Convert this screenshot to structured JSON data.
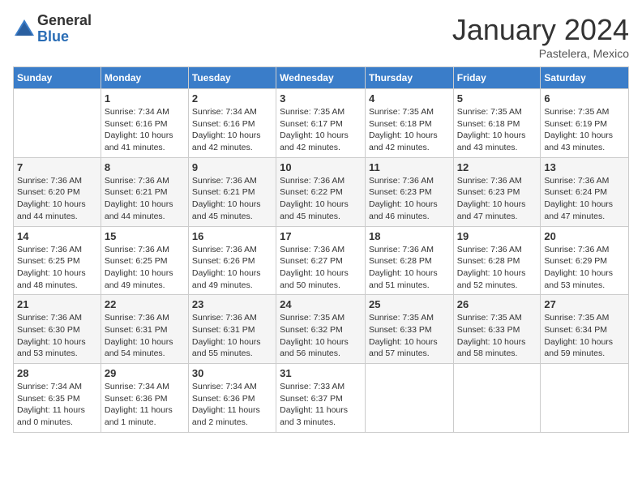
{
  "logo": {
    "general": "General",
    "blue": "Blue"
  },
  "title": "January 2024",
  "location": "Pastelera, Mexico",
  "days_of_week": [
    "Sunday",
    "Monday",
    "Tuesday",
    "Wednesday",
    "Thursday",
    "Friday",
    "Saturday"
  ],
  "weeks": [
    [
      {
        "day": "",
        "sunrise": "",
        "sunset": "",
        "daylight": ""
      },
      {
        "day": "1",
        "sunrise": "Sunrise: 7:34 AM",
        "sunset": "Sunset: 6:16 PM",
        "daylight": "Daylight: 10 hours and 41 minutes."
      },
      {
        "day": "2",
        "sunrise": "Sunrise: 7:34 AM",
        "sunset": "Sunset: 6:16 PM",
        "daylight": "Daylight: 10 hours and 42 minutes."
      },
      {
        "day": "3",
        "sunrise": "Sunrise: 7:35 AM",
        "sunset": "Sunset: 6:17 PM",
        "daylight": "Daylight: 10 hours and 42 minutes."
      },
      {
        "day": "4",
        "sunrise": "Sunrise: 7:35 AM",
        "sunset": "Sunset: 6:18 PM",
        "daylight": "Daylight: 10 hours and 42 minutes."
      },
      {
        "day": "5",
        "sunrise": "Sunrise: 7:35 AM",
        "sunset": "Sunset: 6:18 PM",
        "daylight": "Daylight: 10 hours and 43 minutes."
      },
      {
        "day": "6",
        "sunrise": "Sunrise: 7:35 AM",
        "sunset": "Sunset: 6:19 PM",
        "daylight": "Daylight: 10 hours and 43 minutes."
      }
    ],
    [
      {
        "day": "7",
        "sunrise": "Sunrise: 7:36 AM",
        "sunset": "Sunset: 6:20 PM",
        "daylight": "Daylight: 10 hours and 44 minutes."
      },
      {
        "day": "8",
        "sunrise": "Sunrise: 7:36 AM",
        "sunset": "Sunset: 6:21 PM",
        "daylight": "Daylight: 10 hours and 44 minutes."
      },
      {
        "day": "9",
        "sunrise": "Sunrise: 7:36 AM",
        "sunset": "Sunset: 6:21 PM",
        "daylight": "Daylight: 10 hours and 45 minutes."
      },
      {
        "day": "10",
        "sunrise": "Sunrise: 7:36 AM",
        "sunset": "Sunset: 6:22 PM",
        "daylight": "Daylight: 10 hours and 45 minutes."
      },
      {
        "day": "11",
        "sunrise": "Sunrise: 7:36 AM",
        "sunset": "Sunset: 6:23 PM",
        "daylight": "Daylight: 10 hours and 46 minutes."
      },
      {
        "day": "12",
        "sunrise": "Sunrise: 7:36 AM",
        "sunset": "Sunset: 6:23 PM",
        "daylight": "Daylight: 10 hours and 47 minutes."
      },
      {
        "day": "13",
        "sunrise": "Sunrise: 7:36 AM",
        "sunset": "Sunset: 6:24 PM",
        "daylight": "Daylight: 10 hours and 47 minutes."
      }
    ],
    [
      {
        "day": "14",
        "sunrise": "Sunrise: 7:36 AM",
        "sunset": "Sunset: 6:25 PM",
        "daylight": "Daylight: 10 hours and 48 minutes."
      },
      {
        "day": "15",
        "sunrise": "Sunrise: 7:36 AM",
        "sunset": "Sunset: 6:25 PM",
        "daylight": "Daylight: 10 hours and 49 minutes."
      },
      {
        "day": "16",
        "sunrise": "Sunrise: 7:36 AM",
        "sunset": "Sunset: 6:26 PM",
        "daylight": "Daylight: 10 hours and 49 minutes."
      },
      {
        "day": "17",
        "sunrise": "Sunrise: 7:36 AM",
        "sunset": "Sunset: 6:27 PM",
        "daylight": "Daylight: 10 hours and 50 minutes."
      },
      {
        "day": "18",
        "sunrise": "Sunrise: 7:36 AM",
        "sunset": "Sunset: 6:28 PM",
        "daylight": "Daylight: 10 hours and 51 minutes."
      },
      {
        "day": "19",
        "sunrise": "Sunrise: 7:36 AM",
        "sunset": "Sunset: 6:28 PM",
        "daylight": "Daylight: 10 hours and 52 minutes."
      },
      {
        "day": "20",
        "sunrise": "Sunrise: 7:36 AM",
        "sunset": "Sunset: 6:29 PM",
        "daylight": "Daylight: 10 hours and 53 minutes."
      }
    ],
    [
      {
        "day": "21",
        "sunrise": "Sunrise: 7:36 AM",
        "sunset": "Sunset: 6:30 PM",
        "daylight": "Daylight: 10 hours and 53 minutes."
      },
      {
        "day": "22",
        "sunrise": "Sunrise: 7:36 AM",
        "sunset": "Sunset: 6:31 PM",
        "daylight": "Daylight: 10 hours and 54 minutes."
      },
      {
        "day": "23",
        "sunrise": "Sunrise: 7:36 AM",
        "sunset": "Sunset: 6:31 PM",
        "daylight": "Daylight: 10 hours and 55 minutes."
      },
      {
        "day": "24",
        "sunrise": "Sunrise: 7:35 AM",
        "sunset": "Sunset: 6:32 PM",
        "daylight": "Daylight: 10 hours and 56 minutes."
      },
      {
        "day": "25",
        "sunrise": "Sunrise: 7:35 AM",
        "sunset": "Sunset: 6:33 PM",
        "daylight": "Daylight: 10 hours and 57 minutes."
      },
      {
        "day": "26",
        "sunrise": "Sunrise: 7:35 AM",
        "sunset": "Sunset: 6:33 PM",
        "daylight": "Daylight: 10 hours and 58 minutes."
      },
      {
        "day": "27",
        "sunrise": "Sunrise: 7:35 AM",
        "sunset": "Sunset: 6:34 PM",
        "daylight": "Daylight: 10 hours and 59 minutes."
      }
    ],
    [
      {
        "day": "28",
        "sunrise": "Sunrise: 7:34 AM",
        "sunset": "Sunset: 6:35 PM",
        "daylight": "Daylight: 11 hours and 0 minutes."
      },
      {
        "day": "29",
        "sunrise": "Sunrise: 7:34 AM",
        "sunset": "Sunset: 6:36 PM",
        "daylight": "Daylight: 11 hours and 1 minute."
      },
      {
        "day": "30",
        "sunrise": "Sunrise: 7:34 AM",
        "sunset": "Sunset: 6:36 PM",
        "daylight": "Daylight: 11 hours and 2 minutes."
      },
      {
        "day": "31",
        "sunrise": "Sunrise: 7:33 AM",
        "sunset": "Sunset: 6:37 PM",
        "daylight": "Daylight: 11 hours and 3 minutes."
      },
      {
        "day": "",
        "sunrise": "",
        "sunset": "",
        "daylight": ""
      },
      {
        "day": "",
        "sunrise": "",
        "sunset": "",
        "daylight": ""
      },
      {
        "day": "",
        "sunrise": "",
        "sunset": "",
        "daylight": ""
      }
    ]
  ]
}
